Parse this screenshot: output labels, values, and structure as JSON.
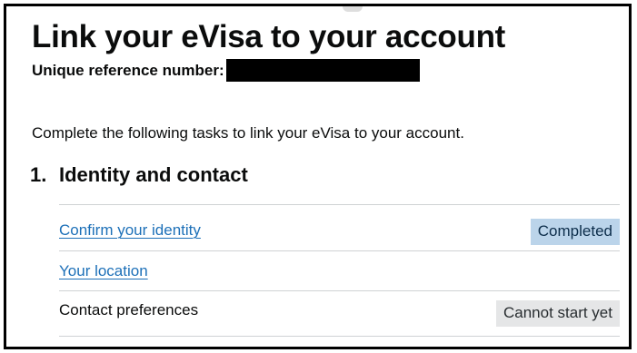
{
  "page": {
    "title": "Link your eVisa to your account",
    "reference_label": "Unique reference number:",
    "intro": "Complete the following tasks to link your eVisa to your account."
  },
  "section": {
    "number": "1.",
    "title": "Identity and contact",
    "tasks": [
      {
        "label": "Confirm your identity",
        "is_link": true,
        "status": "Completed",
        "status_color": "#bbd4ea"
      },
      {
        "label": "Your location",
        "is_link": true,
        "status": ""
      },
      {
        "label": "Contact preferences",
        "is_link": false,
        "status": "Cannot start yet",
        "status_color": "#e5e6e7"
      }
    ]
  },
  "colors": {
    "link": "#1d70b8",
    "text": "#0b0c0c",
    "divider": "#cfd2d4",
    "frame_border": "#000000",
    "redaction": "#000000"
  }
}
